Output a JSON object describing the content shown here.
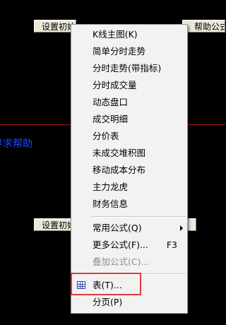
{
  "background": {
    "button_top_left": "设置初始公式(I)",
    "button_top_right": "帮助公式(H)",
    "button_bottom_left": "设置初始",
    "button_bottom_right": "",
    "blue_text": "寻求帮助",
    "line_color": "#b01010",
    "text_color": "#1e46ff"
  },
  "menu": {
    "items": [
      {
        "label": "K线主图(K)"
      },
      {
        "label": "简单分时走势"
      },
      {
        "label": "分时走势(带指标)"
      },
      {
        "label": "分时成交量"
      },
      {
        "label": "动态盘口"
      },
      {
        "label": "成交明细"
      },
      {
        "label": "分价表"
      },
      {
        "label": "未成交堆积图"
      },
      {
        "label": "移动成本分布"
      },
      {
        "label": "主力龙虎"
      },
      {
        "label": "财务信息"
      }
    ],
    "common_formula": "常用公式(Q)",
    "more_formula": "更多公式(F)...",
    "more_formula_shortcut": "F3",
    "overlay_formula": "叠加公式(C)...",
    "table": "表(T)...",
    "paging": "分页(P)",
    "table_icon": "table-icon",
    "highlight_color": "#e0393e"
  }
}
